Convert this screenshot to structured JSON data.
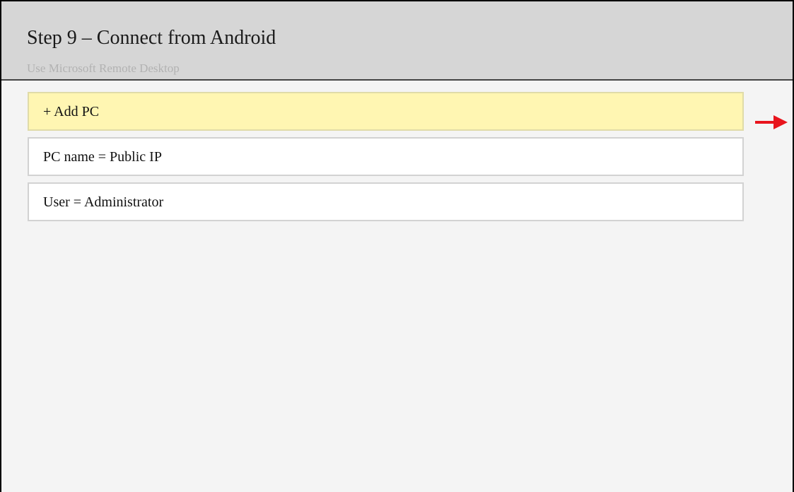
{
  "header": {
    "title": "Step 9 – Connect from Android",
    "subtitle": "Use Microsoft Remote Desktop"
  },
  "rows": [
    {
      "label": "+ Add PC",
      "highlighted": true
    },
    {
      "label": "PC name = Public IP",
      "highlighted": false
    },
    {
      "label": "User = Administrator",
      "highlighted": false
    }
  ],
  "pointer": {
    "icon": "arrow-right-icon",
    "color": "#e8141c"
  },
  "colors": {
    "highlight": "#fff6b2",
    "header_bg": "#d6d6d6",
    "body_bg": "#f4f4f4"
  }
}
